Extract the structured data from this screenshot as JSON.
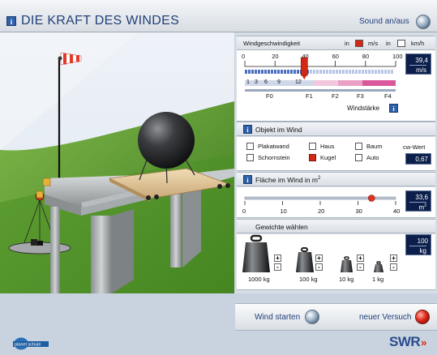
{
  "header": {
    "title": "DIE KRAFT DES WINDES",
    "sound_label": "Sound an/aus",
    "info_icon": "info-icon"
  },
  "wind": {
    "label": "Windgeschwindigkeit",
    "unit_prefix_1": "in",
    "unit_ms": "m/s",
    "unit_prefix_2": "in",
    "unit_kmh": "km/h",
    "selected_unit": "m/s",
    "ticks": [
      "0",
      "20",
      "40",
      "60",
      "80",
      "100"
    ],
    "value": "39,4",
    "value_unit": "m/s",
    "beaufort_numbers": [
      "1",
      "3",
      "6",
      "9",
      "12"
    ],
    "force_labels": [
      "F0",
      "F1",
      "F2",
      "F3",
      "F4"
    ],
    "windstaerke_label": "Windstärke"
  },
  "object": {
    "label": "Objekt im Wind",
    "options": [
      {
        "label": "Plakatwand",
        "checked": false
      },
      {
        "label": "Haus",
        "checked": false
      },
      {
        "label": "Baum",
        "checked": false
      },
      {
        "label": "Schornstein",
        "checked": false
      },
      {
        "label": "Kugel",
        "checked": true
      },
      {
        "label": "Auto",
        "checked": false
      }
    ],
    "cw_label": "cw-Wert",
    "cw_value": "0,67"
  },
  "area": {
    "label": "Fläche im Wind in m",
    "label_sup": "2",
    "ticks": [
      "0",
      "10",
      "20",
      "30",
      "40"
    ],
    "value": "33,6",
    "value_unit": "m",
    "value_unit_sup": "2",
    "level": 0.84
  },
  "weights": {
    "label": "Gewichte wählen",
    "value": "100",
    "value_unit": "kg",
    "items": [
      {
        "label": "1000 kg"
      },
      {
        "label": "100 kg"
      },
      {
        "label": "10 kg"
      },
      {
        "label": "1 kg"
      }
    ],
    "plus": "+",
    "minus": "-"
  },
  "footer": {
    "wind_start": "Wind starten",
    "reset": "neuer Versuch",
    "logo_planet": "planet schule",
    "logo_swr": "SWR",
    "logo_swr_arrows": "»"
  },
  "colors": {
    "title_blue": "#23407a",
    "accent_red": "#d42814",
    "value_box": "#0c1f4a"
  }
}
